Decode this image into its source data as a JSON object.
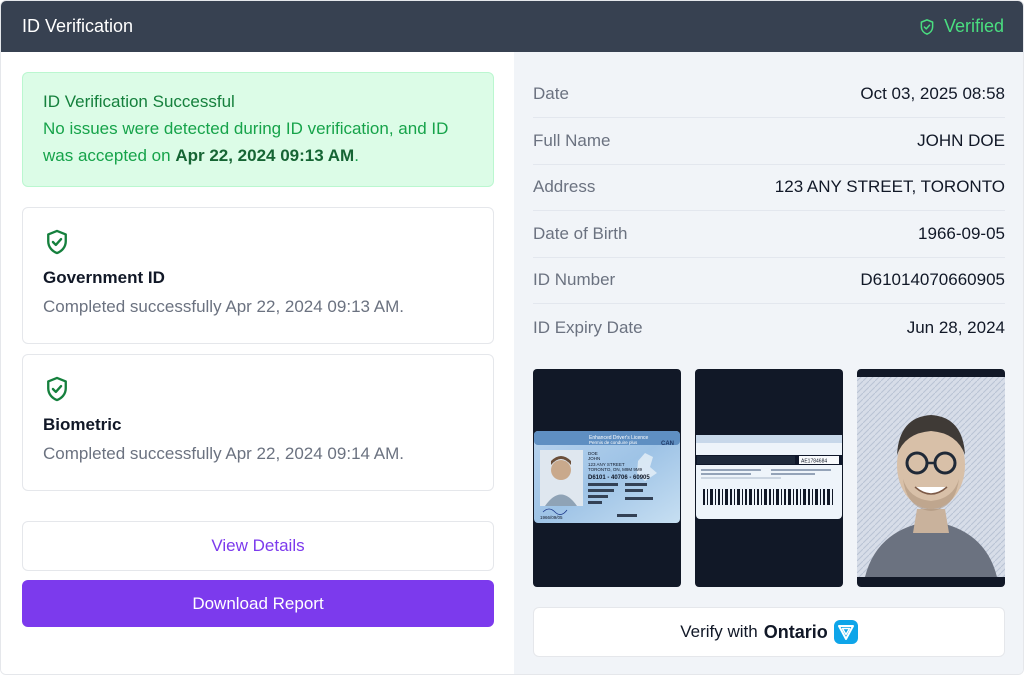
{
  "header": {
    "title": "ID Verification",
    "status": "Verified",
    "status_color": "#4ade80"
  },
  "alert": {
    "title": "ID Verification Successful",
    "message": "No issues were detected during ID verification, and ID was accepted on ",
    "accepted_at": "Apr 22, 2024 09:13 AM",
    "message_end": "."
  },
  "checks": [
    {
      "title": "Government ID",
      "status": "Completed successfully Apr 22, 2024 09:13 AM.",
      "icon": "shield-check-icon"
    },
    {
      "title": "Biometric",
      "status": "Completed successfully Apr 22, 2024 09:14 AM.",
      "icon": "shield-check-icon"
    }
  ],
  "actions": {
    "view_details": "View Details",
    "download_report": "Download Report"
  },
  "details": [
    {
      "label": "Date",
      "value": "Oct 03, 2025 08:58"
    },
    {
      "label": "Full Name",
      "value": "JOHN DOE"
    },
    {
      "label": "Address",
      "value": "123 ANY STREET, TORONTO"
    },
    {
      "label": "Date of Birth",
      "value": "1966-09-05"
    },
    {
      "label": "ID Number",
      "value": "D61014070660905"
    },
    {
      "label": "ID Expiry Date",
      "value": "Jun 28, 2024"
    }
  ],
  "images": {
    "front": {
      "header": "Enhanced Driver's Licence",
      "subheader": "Permis de conduire plus",
      "country": "CAN",
      "surname": "DOE",
      "given_name": "JOHN",
      "address_line": "123 ANY STREET",
      "city_line": "TORONTO, ON, M9M 9M9",
      "number": "D6101 - 40706 - 60905",
      "footer": "1966/09/05"
    },
    "back": {
      "serial": "AE1784684"
    },
    "portrait": "selfie-photo"
  },
  "verify": {
    "prefix": "Verify with",
    "brand": "Ontario",
    "logo": "ontario-trillium-logo"
  },
  "colors": {
    "accent": "#7c3aed",
    "success": "#16a34a",
    "header_bg": "#374151"
  }
}
